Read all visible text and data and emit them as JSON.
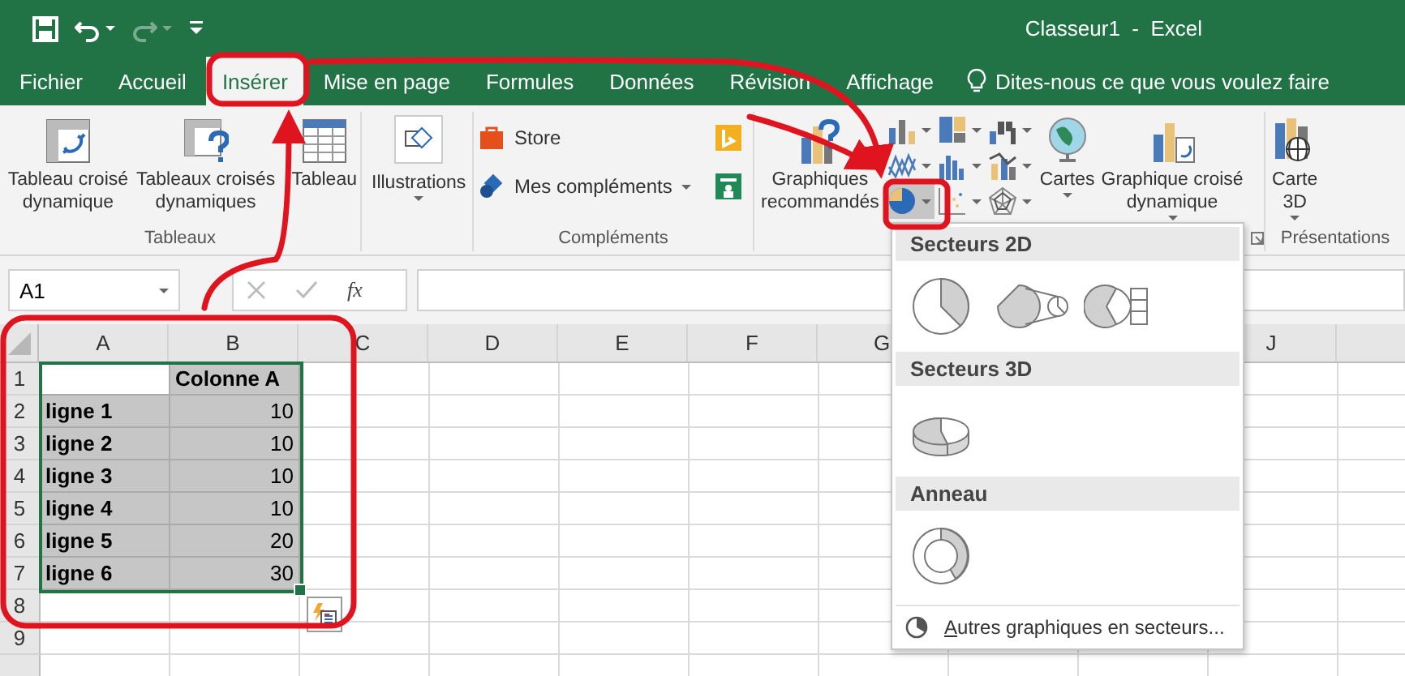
{
  "title_bar": {
    "title": "Classeur1  -  Excel",
    "quick_access": [
      {
        "kind": "save",
        "disabled": false
      },
      {
        "kind": "undo",
        "disabled": false
      },
      {
        "kind": "redo",
        "disabled": true
      },
      {
        "kind": "customize",
        "disabled": false
      }
    ]
  },
  "tabs": [
    {
      "label": "Fichier",
      "selected": false
    },
    {
      "label": "Accueil",
      "selected": false
    },
    {
      "label": "Insérer",
      "selected": true
    },
    {
      "label": "Mise en page",
      "selected": false
    },
    {
      "label": "Formules",
      "selected": false
    },
    {
      "label": "Données",
      "selected": false
    },
    {
      "label": "Révision",
      "selected": false
    },
    {
      "label": "Affichage",
      "selected": false
    }
  ],
  "tell_me": "Dites-nous ce que vous voulez faire",
  "ribbon": {
    "tableaux": {
      "label": "Tableaux",
      "buttons": [
        {
          "kind": "pivot",
          "label": "Tableau croisé\ndynamique"
        },
        {
          "kind": "recommended-pivot",
          "label": "Tableaux croisés\ndynamiques"
        },
        {
          "kind": "table",
          "label": "Tableau"
        }
      ]
    },
    "illustrations": {
      "label": "Illustrations"
    },
    "complements": {
      "label": "Compléments",
      "items": [
        {
          "kind": "store",
          "label": "Store"
        },
        {
          "kind": "addins",
          "label": "Mes compléments"
        }
      ]
    },
    "graphiques": {
      "recommended": "Graphiques\nrecommandés",
      "chart_buttons": [
        {
          "kind": "column",
          "selected": false
        },
        {
          "kind": "hierarchy",
          "selected": false
        },
        {
          "kind": "waterfall",
          "selected": false
        },
        {
          "kind": "line",
          "selected": false
        },
        {
          "kind": "statistic",
          "selected": false
        },
        {
          "kind": "combo",
          "selected": false
        },
        {
          "kind": "pie",
          "selected": true
        },
        {
          "kind": "scatter",
          "selected": false
        },
        {
          "kind": "radar",
          "selected": false
        }
      ],
      "maps": "Cartes",
      "pivot_chart": "Graphique croisé\ndynamique"
    },
    "presentations": {
      "label": "Présentations",
      "button": "Carte\n3D"
    }
  },
  "formula_bar": {
    "name_box": "A1",
    "fx": "fx"
  },
  "sheet": {
    "columns": [
      "A",
      "B",
      "C",
      "D",
      "E",
      "F",
      "G",
      null,
      null,
      "J"
    ],
    "rows": [
      {
        "header": "1",
        "cells": [
          {
            "kind": "empty",
            "selected": true,
            "active": true
          },
          {
            "kind": "label",
            "text": "Colonne A",
            "selected": true,
            "active": false
          }
        ]
      },
      {
        "header": "2",
        "cells": [
          {
            "kind": "label",
            "text": "ligne 1",
            "selected": true,
            "active": false
          },
          {
            "kind": "number",
            "text": "10",
            "selected": true,
            "active": false
          }
        ]
      },
      {
        "header": "3",
        "cells": [
          {
            "kind": "label",
            "text": "ligne 2",
            "selected": true,
            "active": false
          },
          {
            "kind": "number",
            "text": "10",
            "selected": true,
            "active": false
          }
        ]
      },
      {
        "header": "4",
        "cells": [
          {
            "kind": "label",
            "text": "ligne 3",
            "selected": true,
            "active": false
          },
          {
            "kind": "number",
            "text": "10",
            "selected": true,
            "active": false
          }
        ]
      },
      {
        "header": "5",
        "cells": [
          {
            "kind": "label",
            "text": "ligne 4",
            "selected": true,
            "active": false
          },
          {
            "kind": "number",
            "text": "10",
            "selected": true,
            "active": false
          }
        ]
      },
      {
        "header": "6",
        "cells": [
          {
            "kind": "label",
            "text": "ligne 5",
            "selected": true,
            "active": false
          },
          {
            "kind": "number",
            "text": "20",
            "selected": true,
            "active": false
          }
        ]
      },
      {
        "header": "7",
        "cells": [
          {
            "kind": "label",
            "text": "ligne 6",
            "selected": true,
            "active": false
          },
          {
            "kind": "number",
            "text": "30",
            "selected": true,
            "active": false
          }
        ]
      },
      {
        "header": "8",
        "cells": []
      },
      {
        "header": "9",
        "cells": []
      }
    ]
  },
  "pie_menu": {
    "sections": [
      {
        "title": "Secteurs 2D",
        "items": [
          {
            "kind": "pie"
          },
          {
            "kind": "pie-of-pie"
          },
          {
            "kind": "bar-of-pie"
          }
        ]
      },
      {
        "title": "Secteurs 3D",
        "items": [
          {
            "kind": "pie-3d"
          }
        ]
      },
      {
        "title": "Anneau",
        "items": [
          {
            "kind": "doughnut"
          }
        ]
      }
    ],
    "footer": "Autres graphiques en secteurs..."
  }
}
